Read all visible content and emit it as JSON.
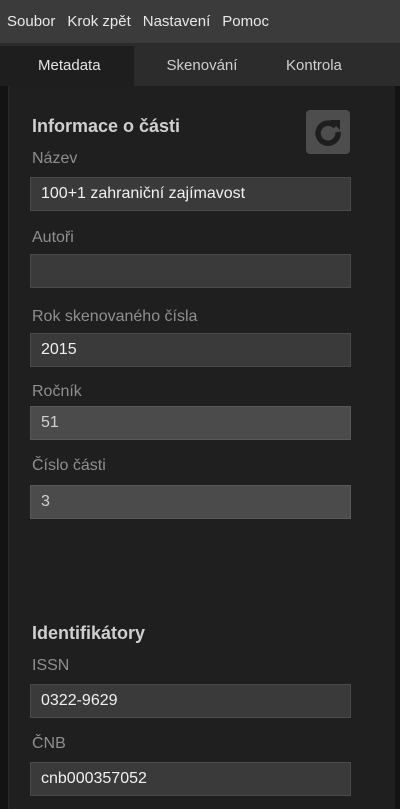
{
  "menubar": {
    "items": [
      "Soubor",
      "Krok zpět",
      "Nastavení",
      "Pomoc"
    ]
  },
  "tabs": {
    "items": [
      "Metadata",
      "Skenování",
      "Kontrola"
    ],
    "active": "Metadata"
  },
  "section_part": {
    "title": "Informace o části",
    "refresh_icon": "refresh-icon",
    "fields": [
      {
        "label": "Název",
        "value": "100+1 zahraniční zajímavost",
        "editable": true
      },
      {
        "label": "Autoři",
        "value": "",
        "editable": true
      },
      {
        "label": "Rok skenovaného čísla",
        "value": "2015",
        "editable": true
      },
      {
        "label": "Ročník",
        "value": "51",
        "editable": false
      },
      {
        "label": "Číslo části",
        "value": "3",
        "editable": false
      }
    ]
  },
  "section_ids": {
    "title": "Identifikátory",
    "fields": [
      {
        "label": "ISSN",
        "value": "0322-9629",
        "editable": true
      },
      {
        "label": "ČNB",
        "value": "cnb000357052",
        "editable": true
      }
    ]
  },
  "colors": {
    "background": "#131313",
    "panel": "#1f1f1f",
    "field": "#3a3a3a",
    "field_dim": "#4b4b4b",
    "text": "#f0f0f0",
    "label": "#8f8f8f"
  }
}
